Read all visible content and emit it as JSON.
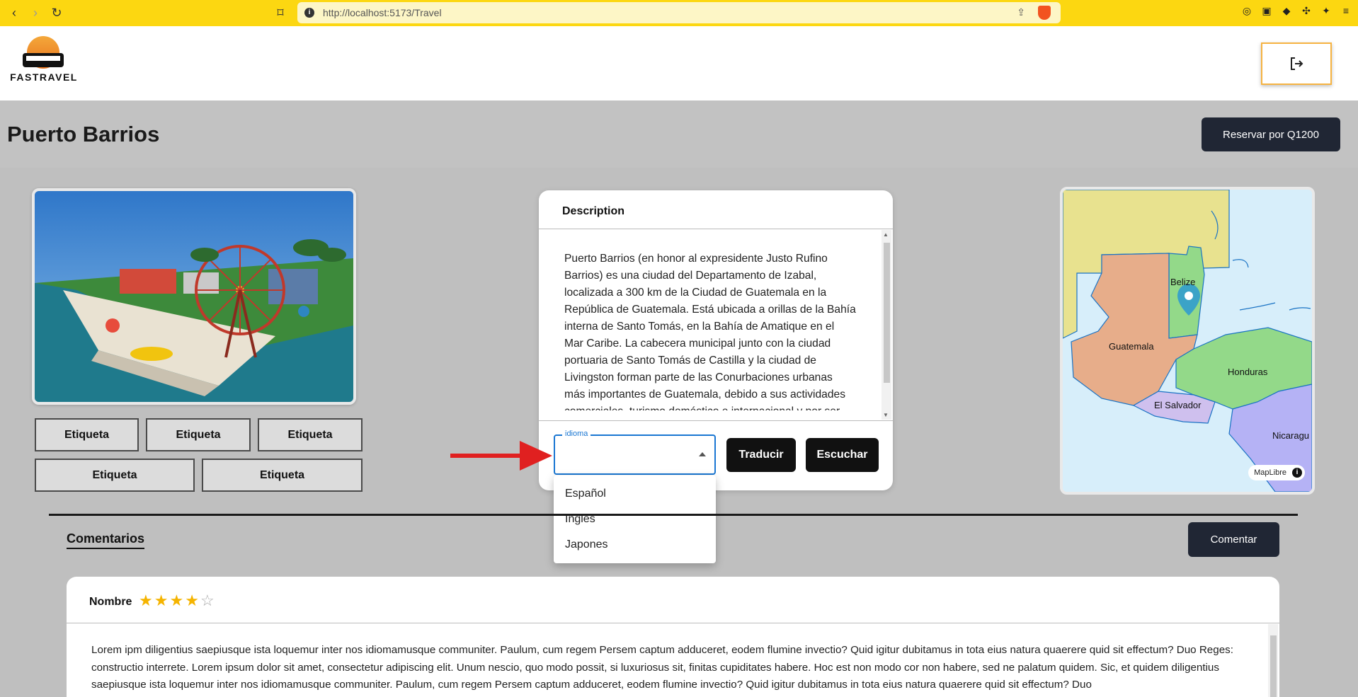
{
  "browser": {
    "url": "http://localhost:5173/Travel"
  },
  "header": {
    "logo_text": "FASTRAVEL"
  },
  "page": {
    "title": "Puerto Barrios",
    "reserve_label": "Reservar por Q1200"
  },
  "tags": [
    "Etiqueta",
    "Etiqueta",
    "Etiqueta",
    "Etiqueta",
    "Etiqueta"
  ],
  "description": {
    "title": "Description",
    "body": "Puerto Barrios (en honor al expresidente Justo Rufino Barrios) es una ciudad del Departamento de Izabal, localizada a 300 km de la Ciudad de Guatemala en la República de Guatemala. Está ubicada a orillas de la Bahía interna de Santo Tomás, en la Bahía de Amatique en el Mar Caribe. La cabecera municipal junto con la ciudad portuaria de Santo Tomás de Castilla y la ciudad de Livingston forman parte de las Conurbaciones urbanas más importantes de Guatemala, debido a sus actividades comerciales, turismo doméstico e internacional y por ser",
    "language_label": "idioma",
    "language_value": "",
    "translate_label": "Traducir",
    "listen_label": "Escuchar",
    "language_options": [
      "Español",
      "Ingles",
      "Japones"
    ]
  },
  "map": {
    "labels": {
      "belize": "Belize",
      "guatemala": "Guatemala",
      "honduras": "Honduras",
      "el_salvador": "El Salvador",
      "nicaragua": "Nicaragu"
    },
    "attribution": "MapLibre",
    "info": "i"
  },
  "comments": {
    "title": "Comentarios",
    "add_label": "Comentar",
    "items": [
      {
        "name": "Nombre",
        "rating": 4,
        "max_rating": 5,
        "body": "Lorem ipm diligentius saepiusque ista loquemur inter nos idiomamusque communiter. Paulum, cum regem Persem captum adduceret, eodem flumine invectio? Quid igitur dubitamus in tota eius natura quaerere quid sit effectum? Duo Reges: constructio interrete. Lorem ipsum dolor sit amet, consectetur adipiscing elit. Unum nescio, quo modo possit, si luxuriosus sit, finitas cupiditates habere. Hoc est non modo cor non habere, sed ne palatum quidem. Sic, et quidem diligentius saepiusque ista loquemur inter nos idiomamusque communiter. Paulum, cum regem Persem captum adduceret, eodem flumine invectio? Quid igitur dubitamus in tota eius natura quaerere quid sit effectum? Duo"
      }
    ]
  },
  "colors": {
    "browser_bar": "#fcd711",
    "dark_button": "#202634",
    "accent_border": "#f6b341",
    "select_focus": "#1976d2",
    "star": "#f5b400",
    "arrow": "#e02020"
  }
}
